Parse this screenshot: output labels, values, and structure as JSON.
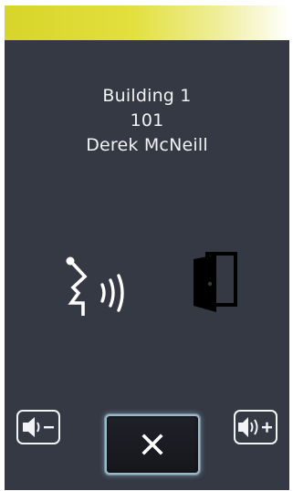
{
  "caller": {
    "building": "Building 1",
    "unit": "101",
    "name": "Derek McNeill"
  },
  "icons": {
    "status": "speaking-icon",
    "door": "door-open-icon",
    "volume_down": "volume-down-icon",
    "volume_up": "volume-up-icon",
    "close": "close-icon"
  },
  "colors": {
    "background": "#353944",
    "accent_bar": "#e3e03e",
    "text": "#f2f3f5"
  }
}
